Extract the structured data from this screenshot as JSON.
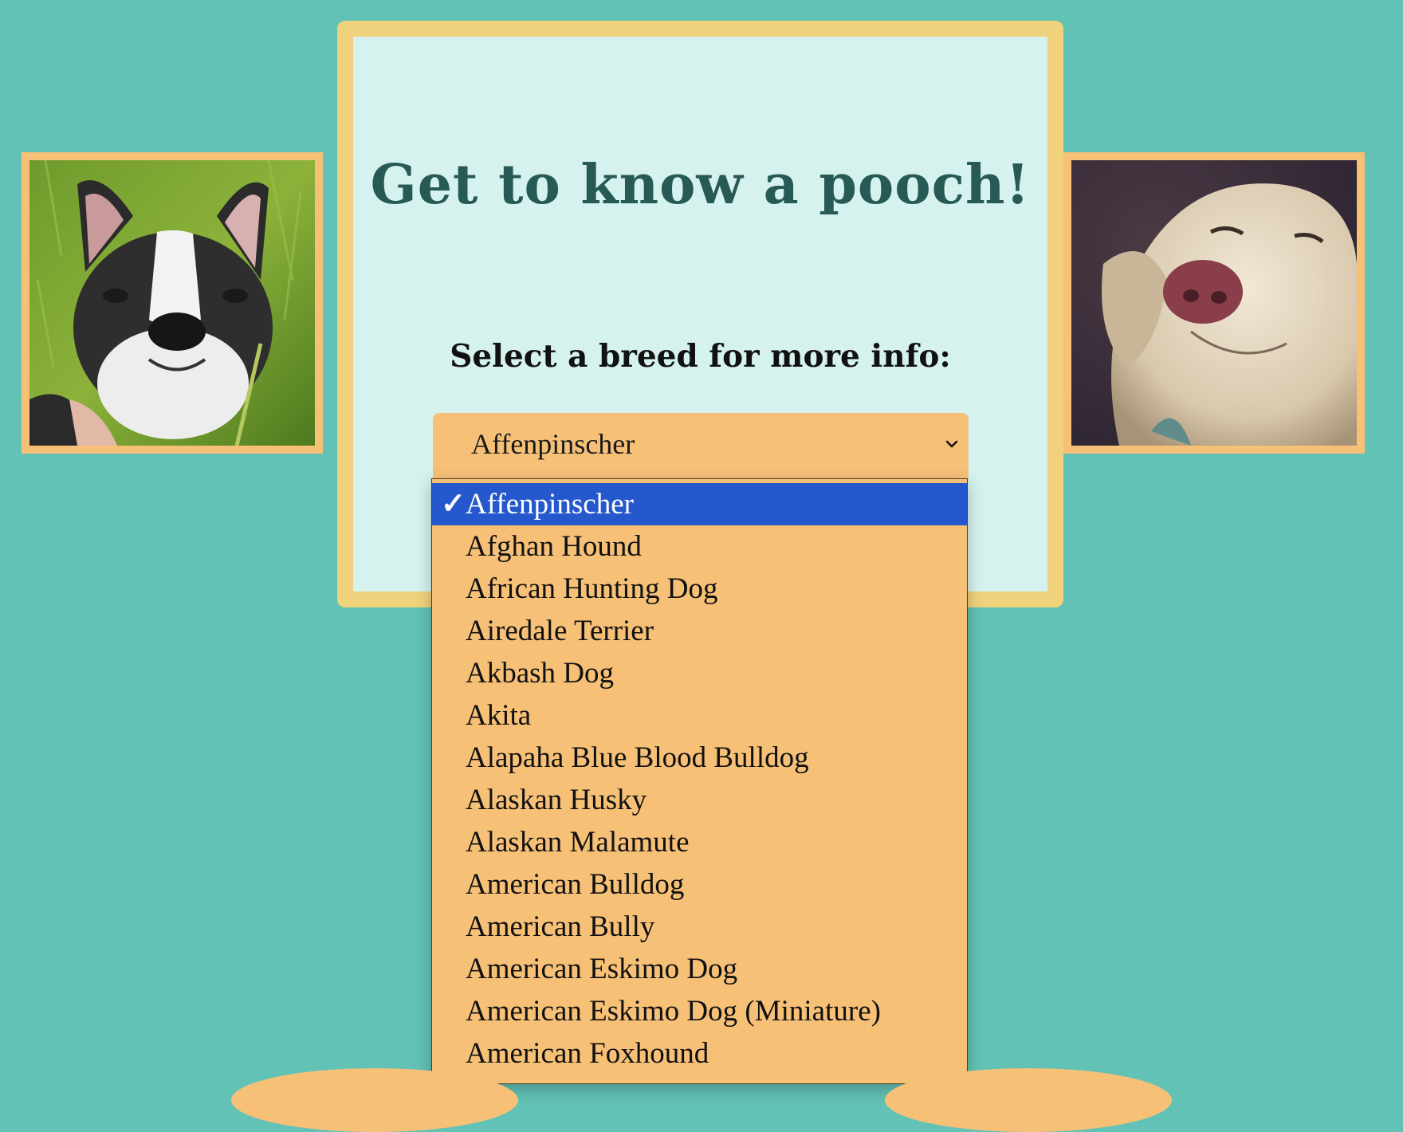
{
  "header": {
    "title": "Get to know a pooch!",
    "subtitle": "Select a breed for more info:"
  },
  "breed_select": {
    "selected": "Affenpinscher",
    "caret_icon": "chevron-down-icon",
    "check_mark": "✓",
    "options": [
      "Affenpinscher",
      "Afghan Hound",
      "African Hunting Dog",
      "Airedale Terrier",
      "Akbash Dog",
      "Akita",
      "Alapaha Blue Blood Bulldog",
      "Alaskan Husky",
      "Alaskan Malamute",
      "American Bulldog",
      "American Bully",
      "American Eskimo Dog",
      "American Eskimo Dog (Miniature)",
      "American Foxhound"
    ]
  },
  "photos": {
    "left": "french-bulldog-photo",
    "right": "labrador-photo"
  },
  "colors": {
    "page_background": "#62c2b5",
    "card_border": "#f0d27c",
    "card_background": "#d5f2ef",
    "title_color": "#275a55",
    "select_background": "#f6c077",
    "selected_option": "#2558cc"
  }
}
